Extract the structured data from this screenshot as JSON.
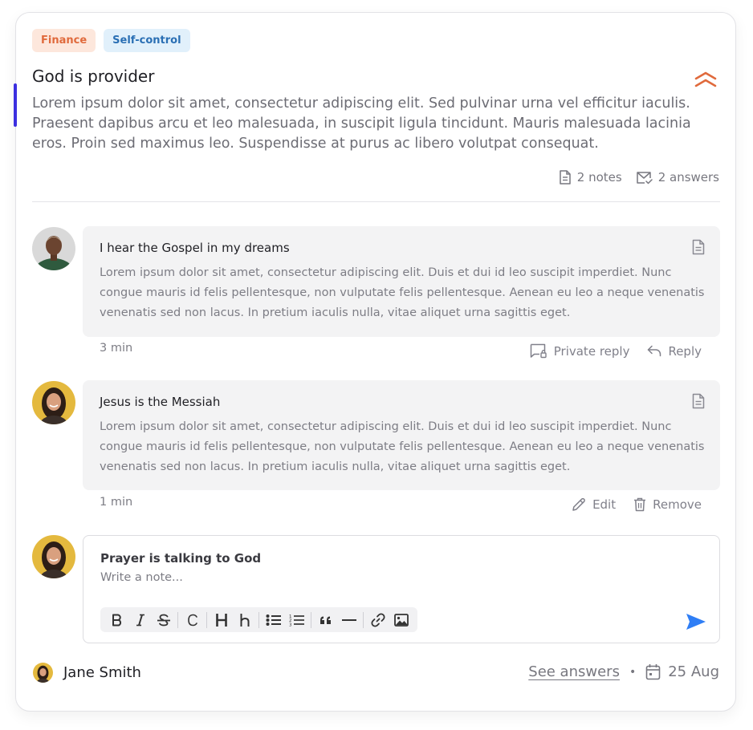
{
  "tags": [
    {
      "label": "Finance"
    },
    {
      "label": "Self-control"
    }
  ],
  "post": {
    "title": "God is provider",
    "description": "Lorem ipsum dolor sit amet, consectetur adipiscing elit. Sed pulvinar urna vel efficitur iaculis. Praesent dapibus arcu et leo malesuada, in suscipit ligula tincidunt. Mauris malesuada lacinia eros. Proin sed maximus leo. Suspendisse at purus ac libero volutpat consequat.",
    "notes_count": "2 notes",
    "answers_count": "2 answers"
  },
  "comments": [
    {
      "title": "I hear the Gospel in my dreams",
      "body": "Lorem ipsum dolor sit amet, consectetur adipiscing elit. Duis et dui id leo suscipit imperdiet. Nunc congue mauris id felis pellentesque, non vulputate felis pellentesque. Aenean eu leo a neque venenatis venenatis sed non lacus. In pretium iaculis nulla, vitae aliquet urna sagittis eget.",
      "time": "3 min",
      "actions": [
        "Private reply",
        "Reply"
      ]
    },
    {
      "title": "Jesus is the Messiah",
      "body": "Lorem ipsum dolor sit amet, consectetur adipiscing elit. Duis et dui id leo suscipit imperdiet. Nunc congue mauris id felis pellentesque, non vulputate felis pellentesque. Aenean eu leo a neque venenatis venenatis sed non lacus. In pretium iaculis nulla, vitae aliquet urna sagittis eget.",
      "time": "1 min",
      "actions": [
        "Edit",
        "Remove"
      ]
    }
  ],
  "editor": {
    "title": "Prayer is talking to God",
    "placeholder": "Write a note...",
    "value": ""
  },
  "footer": {
    "author": "Jane Smith",
    "see_answers": "See answers",
    "separator": "•",
    "date": "25 Aug"
  },
  "colors": {
    "accent": "#3c2fe0",
    "send": "#2f7ef5",
    "collapse": "#e06a3c"
  }
}
